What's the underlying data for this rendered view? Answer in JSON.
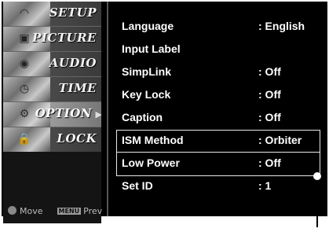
{
  "sidebar": {
    "items": [
      {
        "label": "SETUP",
        "icon": "dish-icon",
        "active": false
      },
      {
        "label": "PICTURE",
        "icon": "picture-icon",
        "active": false
      },
      {
        "label": "AUDIO",
        "icon": "speaker-icon",
        "active": false
      },
      {
        "label": "TIME",
        "icon": "clock-icon",
        "active": false
      },
      {
        "label": "OPTION",
        "icon": "option-icon",
        "active": true
      },
      {
        "label": "LOCK",
        "icon": "lock-icon",
        "active": false
      }
    ]
  },
  "help": {
    "move_label": "Move",
    "menu_key": "MENU",
    "prev_label": "Prev"
  },
  "settings": {
    "rows": [
      {
        "name": "Language",
        "value": ": English"
      },
      {
        "name": "Input Label",
        "value": ""
      },
      {
        "name": "SimpLink",
        "value": ": Off"
      },
      {
        "name": "Key Lock",
        "value": ": Off"
      },
      {
        "name": "Caption",
        "value": ": Off"
      },
      {
        "name": "ISM Method",
        "value": ": Orbiter"
      },
      {
        "name": "Low Power",
        "value": ": Off"
      },
      {
        "name": "Set ID",
        "value": ": 1"
      }
    ]
  },
  "colors": {
    "background": "#000000",
    "text": "#ffffff",
    "highlight_border": "#e8e8e8"
  }
}
